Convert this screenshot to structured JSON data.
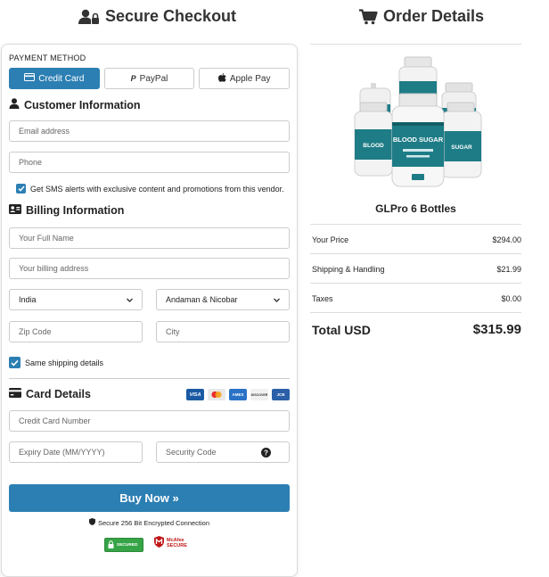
{
  "left_title": "Secure Checkout",
  "right_title": "Order Details",
  "payment": {
    "label": "PAYMENT METHOD",
    "tabs": [
      {
        "label": "Credit Card",
        "icon": "credit-card-icon",
        "active": true
      },
      {
        "label": "PayPal",
        "icon": "paypal-icon",
        "active": false
      },
      {
        "label": "Apple Pay",
        "icon": "apple-icon",
        "active": false
      }
    ]
  },
  "customer": {
    "heading": "Customer Information",
    "email_placeholder": "Email address",
    "phone_placeholder": "Phone",
    "sms_label": "Get SMS alerts with exclusive content and promotions from this vendor."
  },
  "billing": {
    "heading": "Billing Information",
    "name_placeholder": "Your Full Name",
    "address_placeholder": "Your billing address",
    "country": "India",
    "state": "Andaman & Nicobar",
    "zip_placeholder": "Zip Code",
    "city_placeholder": "City",
    "same_shipping_label": "Same shipping details"
  },
  "card": {
    "heading": "Card Details",
    "logos": [
      "VISA",
      "MC",
      "AMEX",
      "DISCOVER",
      "JCB"
    ],
    "number_placeholder": "Credit Card Number",
    "expiry_placeholder": "Expiry Date (MM/YYYY)",
    "cvv_placeholder": "Security Code"
  },
  "buy_button": "Buy Now »",
  "secure_text": "Secure 256 Bit Encrypted Connection",
  "badges": {
    "secured": "SECURED",
    "mcafee_1": "McAfee",
    "mcafee_2": "SECURE"
  },
  "order": {
    "product_name": "GLPro 6 Bottles",
    "bottle_label": "BLOOD SUGAR",
    "rows": [
      {
        "label": "Your Price",
        "value": "$294.00"
      },
      {
        "label": "Shipping & Handling",
        "value": "$21.99"
      },
      {
        "label": "Taxes",
        "value": "$0.00"
      }
    ],
    "total_label": "Total USD",
    "total_value": "$315.99"
  },
  "colors": {
    "accent": "#2c7fb3",
    "teal_bottle": "#1e7c86"
  }
}
